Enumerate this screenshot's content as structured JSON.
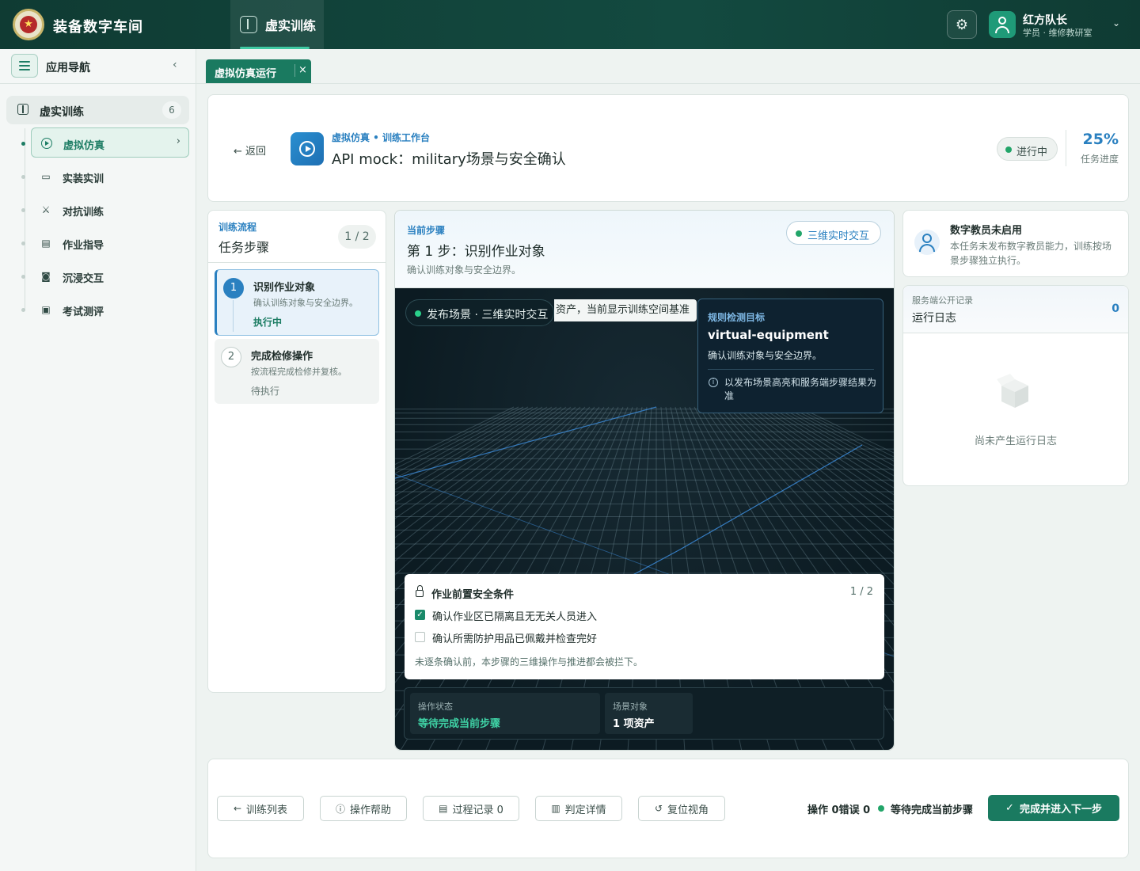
{
  "app": {
    "title": "装备数字车间",
    "top_nav": "虚实训练",
    "user": {
      "name": "红方队长",
      "role": "学员 · 维修教研室"
    }
  },
  "sidebar": {
    "title": "应用导航",
    "group": {
      "label": "虚实训练",
      "count": "6"
    },
    "items": [
      {
        "label": "虚拟仿真",
        "icon": "play-circle-icon",
        "active": true
      },
      {
        "label": "实装实训",
        "icon": "monitor-icon"
      },
      {
        "label": "对抗训练",
        "icon": "crossed-swords-icon"
      },
      {
        "label": "作业指导",
        "icon": "document-icon"
      },
      {
        "label": "沉浸交互",
        "icon": "vr-goggles-icon"
      },
      {
        "label": "考试测评",
        "icon": "clipboard-icon"
      }
    ]
  },
  "tabs": [
    {
      "label": "虚拟仿真运行",
      "close": "×"
    }
  ],
  "header": {
    "back": "返回",
    "breadcrumb": "虚拟仿真 • 训练工作台",
    "title": "API mock：military场景与安全确认",
    "status": "进行中",
    "progress": "25%",
    "progress_label": "任务进度"
  },
  "steps": {
    "caption": "训练流程",
    "title": "任务步骤",
    "count": "1 / 2",
    "list": [
      {
        "num": "1",
        "title": "识别作业对象",
        "desc": "确认训练对象与安全边界。",
        "status": "执行中"
      },
      {
        "num": "2",
        "title": "完成检修操作",
        "desc": "按流程完成检修并复核。",
        "status": "待执行"
      }
    ]
  },
  "current": {
    "caption": "当前步骤",
    "title": "第 1 步：识别作业对象",
    "desc": "确认训练对象与安全边界。",
    "mode": "三维实时交互"
  },
  "viewport": {
    "scene_pill": "发布场景 · 三维实时交互",
    "scene_marquee": "资产，当前显示训练空间基准",
    "rule": {
      "caption": "规则检测目标",
      "target": "virtual-equipment",
      "desc": "确认训练对象与安全边界。",
      "note": "以发布场景高亮和服务端步骤结果为准"
    },
    "safety": {
      "title": "作业前置安全条件",
      "count": "1 / 2",
      "items": [
        {
          "label": "确认作业区已隔离且无无关人员进入",
          "checked": true
        },
        {
          "label": "确认所需防护用品已佩戴并检查完好",
          "checked": false
        }
      ],
      "note": "未逐条确认前，本步骤的三维操作与推进都会被拦下。"
    },
    "ops": [
      {
        "label": "操作状态",
        "value": "等待完成当前步骤",
        "color": "#3fd3a6"
      },
      {
        "label": "场景对象",
        "value": "1 项资产",
        "color": "#ffffff"
      }
    ]
  },
  "instructor": {
    "title": "数字教员未启用",
    "desc": "本任务未发布数字教员能力，训练按场景步骤独立执行。"
  },
  "log": {
    "caption": "服务端公开记录",
    "title": "运行日志",
    "count": "0",
    "empty": "尚未产生运行日志"
  },
  "footer": {
    "buttons": [
      {
        "label": "训练列表",
        "icon": "arrow-left-icon"
      },
      {
        "label": "操作帮助",
        "icon": "info-icon"
      },
      {
        "label": "过程记录 0",
        "icon": "document-icon"
      },
      {
        "label": "判定详情",
        "icon": "report-icon"
      },
      {
        "label": "复位视角",
        "icon": "reset-icon"
      }
    ],
    "stats": "操作 0错误 0",
    "status": "等待完成当前步骤",
    "primary": "完成并进入下一步"
  },
  "colors": {
    "brand": "#1a7a60",
    "accent": "#2a80c0",
    "header_bg": "#0f3b33",
    "success": "#22a569"
  }
}
